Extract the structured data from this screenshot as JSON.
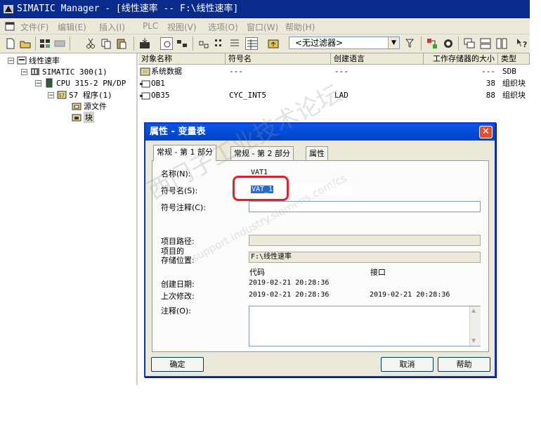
{
  "window": {
    "title": "SIMATIC Manager - [线性速率 -- F:\\线性速率]"
  },
  "menu": [
    "文件(F)",
    "编辑(E)",
    "插入(I)",
    "PLC",
    "视图(V)",
    "选项(O)",
    "窗口(W)",
    "帮助(H)"
  ],
  "toolbar": {
    "filter_value": "<无过滤器>"
  },
  "tree": {
    "root": "线性速率",
    "station": "SIMATIC 300(1)",
    "cpu": "CPU 315-2 PN/DP",
    "program": "S7 程序(1)",
    "sources": "源文件",
    "blocks": "块"
  },
  "list": {
    "columns": [
      "对象名称",
      "符号名",
      "创建语言",
      "工作存储器的大小",
      "类型"
    ],
    "rows": [
      {
        "name": "系统数据",
        "symbol": "---",
        "language": "---",
        "size": "---",
        "type": "SDB"
      },
      {
        "name": "OB1",
        "symbol": "",
        "language": "",
        "size": "38",
        "type": "组织块"
      },
      {
        "name": "OB35",
        "symbol": "CYC_INT5",
        "language": "LAD",
        "size": "88",
        "type": "组织块"
      }
    ]
  },
  "dialog": {
    "title": "属性 - 变量表",
    "tabs": [
      "常规 - 第 1 部分",
      "常规 - 第 2 部分",
      "属性"
    ],
    "name_label": "名称(N):",
    "name_value": "VAT1",
    "symbol_label": "符号名(S):",
    "symbol_value": "VAT_1",
    "symbol_comment_label": "符号注释(C):",
    "symbol_comment_value": "",
    "project_path_label": "项目路径:",
    "project_path_value": "",
    "storage_label_1": "项目的",
    "storage_label_2": "存储位置:",
    "storage_value": "F:\\线性速率",
    "code_header": "代码",
    "interface_header": "接口",
    "created_label": "创建日期:",
    "created_code": "2019-02-21 20:28:36",
    "modified_label": "上次修改:",
    "modified_code": "2019-02-21 20:28:36",
    "modified_interface": "2019-02-21 20:28:36",
    "comment_label": "注释(O):",
    "comment_value": "",
    "ok_label": "确定",
    "cancel_label": "取消",
    "help_label": "帮助"
  },
  "watermark": {
    "line1": "西门子工业技术论坛",
    "line2": "support.industry.siemens.com/cs"
  }
}
